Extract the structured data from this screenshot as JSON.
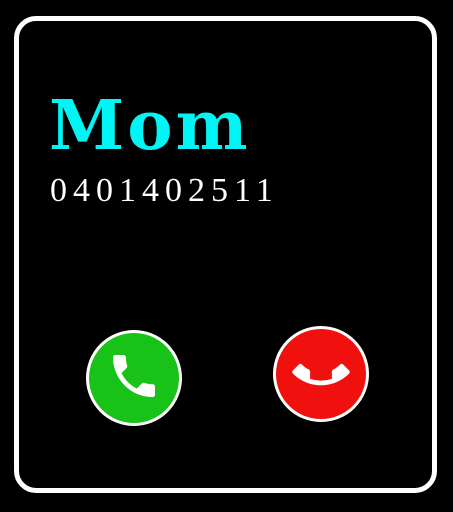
{
  "call": {
    "caller_name": "Mom",
    "caller_number": "0401402511"
  },
  "actions": {
    "accept": {
      "icon": "phone-answer-icon",
      "color": "#19c219"
    },
    "decline": {
      "icon": "phone-hangup-icon",
      "color": "#f0100e"
    }
  },
  "colors": {
    "background": "#000000",
    "frame": "#ffffff",
    "name_accent": "#00f5f5",
    "number_text": "#ffffff"
  }
}
